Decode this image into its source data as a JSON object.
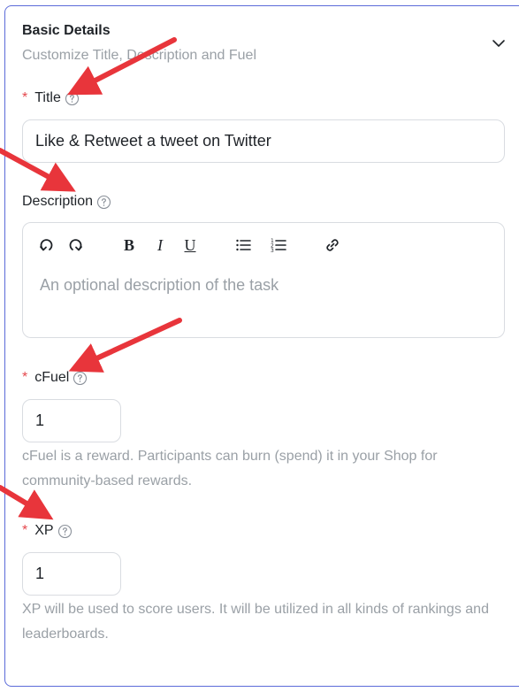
{
  "section": {
    "title": "Basic Details",
    "subtitle": "Customize Title, Description and Fuel",
    "icon": "chevron-down-icon"
  },
  "fields": {
    "title": {
      "required_mark": "*",
      "label": "Title",
      "value": "Like & Retweet a tweet on Twitter"
    },
    "description": {
      "label": "Description",
      "placeholder": "An optional description of the task",
      "toolbar": {
        "undo": "undo-icon",
        "redo": "redo-icon",
        "bold": "B",
        "italic": "I",
        "underline": "U",
        "bullet_list": "bullet-list-icon",
        "ordered_list": "ordered-list-icon",
        "link": "link-icon"
      }
    },
    "cfuel": {
      "required_mark": "*",
      "label": "cFuel",
      "value": "1",
      "help": "cFuel is a reward. Participants can burn (spend) it in your Shop for community-based rewards."
    },
    "xp": {
      "required_mark": "*",
      "label": "XP",
      "value": "1",
      "help": "XP will be used to score users. It will be utilized in all kinds of rankings and leaderboards."
    }
  },
  "colors": {
    "border_accent": "#5b6bd9",
    "required": "#e5484d",
    "annotation_arrow": "#e8353b",
    "muted_text": "#9aa0a6"
  }
}
